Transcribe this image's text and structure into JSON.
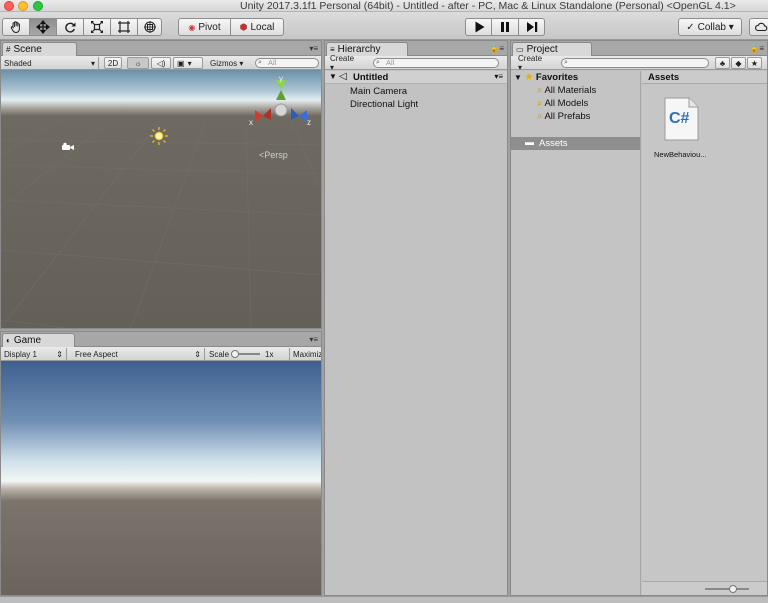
{
  "window": {
    "title": "Unity 2017.3.1f1 Personal (64bit) - Untitled - after - PC, Mac & Linux Standalone (Personal) <OpenGL 4.1>",
    "traffic_lights": [
      "#ff5f57",
      "#febc2e",
      "#28c840"
    ]
  },
  "toolbar": {
    "tools": [
      "hand-icon",
      "move-icon",
      "rotate-icon",
      "scale-icon",
      "rect-icon",
      "transform-icon"
    ],
    "pivot_label": "Pivot",
    "local_label": "Local",
    "play_icons": [
      "play-icon",
      "pause-icon",
      "step-icon"
    ],
    "collab_label": "Collab ▾"
  },
  "scene": {
    "tab": "Scene",
    "shading": "Shaded",
    "mode_2d": "2D",
    "gizmos": "Gizmos ▾",
    "search_placeholder": "All",
    "persp_label": "<Persp",
    "axis_x": "x",
    "axis_y": "y",
    "axis_z": "z"
  },
  "game": {
    "tab": "Game",
    "display": "Display 1",
    "aspect": "Free Aspect",
    "scale_label": "Scale",
    "scale_value": "1x",
    "maximize": "Maximiz"
  },
  "hierarchy": {
    "tab": "Hierarchy",
    "create": "Create ▾",
    "search_placeholder": "All",
    "scene_name": "Untitled",
    "items": [
      "Main Camera",
      "Directional Light"
    ]
  },
  "project": {
    "tab": "Project",
    "create": "Create ▾",
    "favorites_label": "Favorites",
    "favorites": [
      "All Materials",
      "All Models",
      "All Prefabs"
    ],
    "assets_folder": "Assets",
    "assets_header": "Assets",
    "asset_files": [
      {
        "name": "NewBehaviou...",
        "icon_text": "C#"
      }
    ]
  }
}
